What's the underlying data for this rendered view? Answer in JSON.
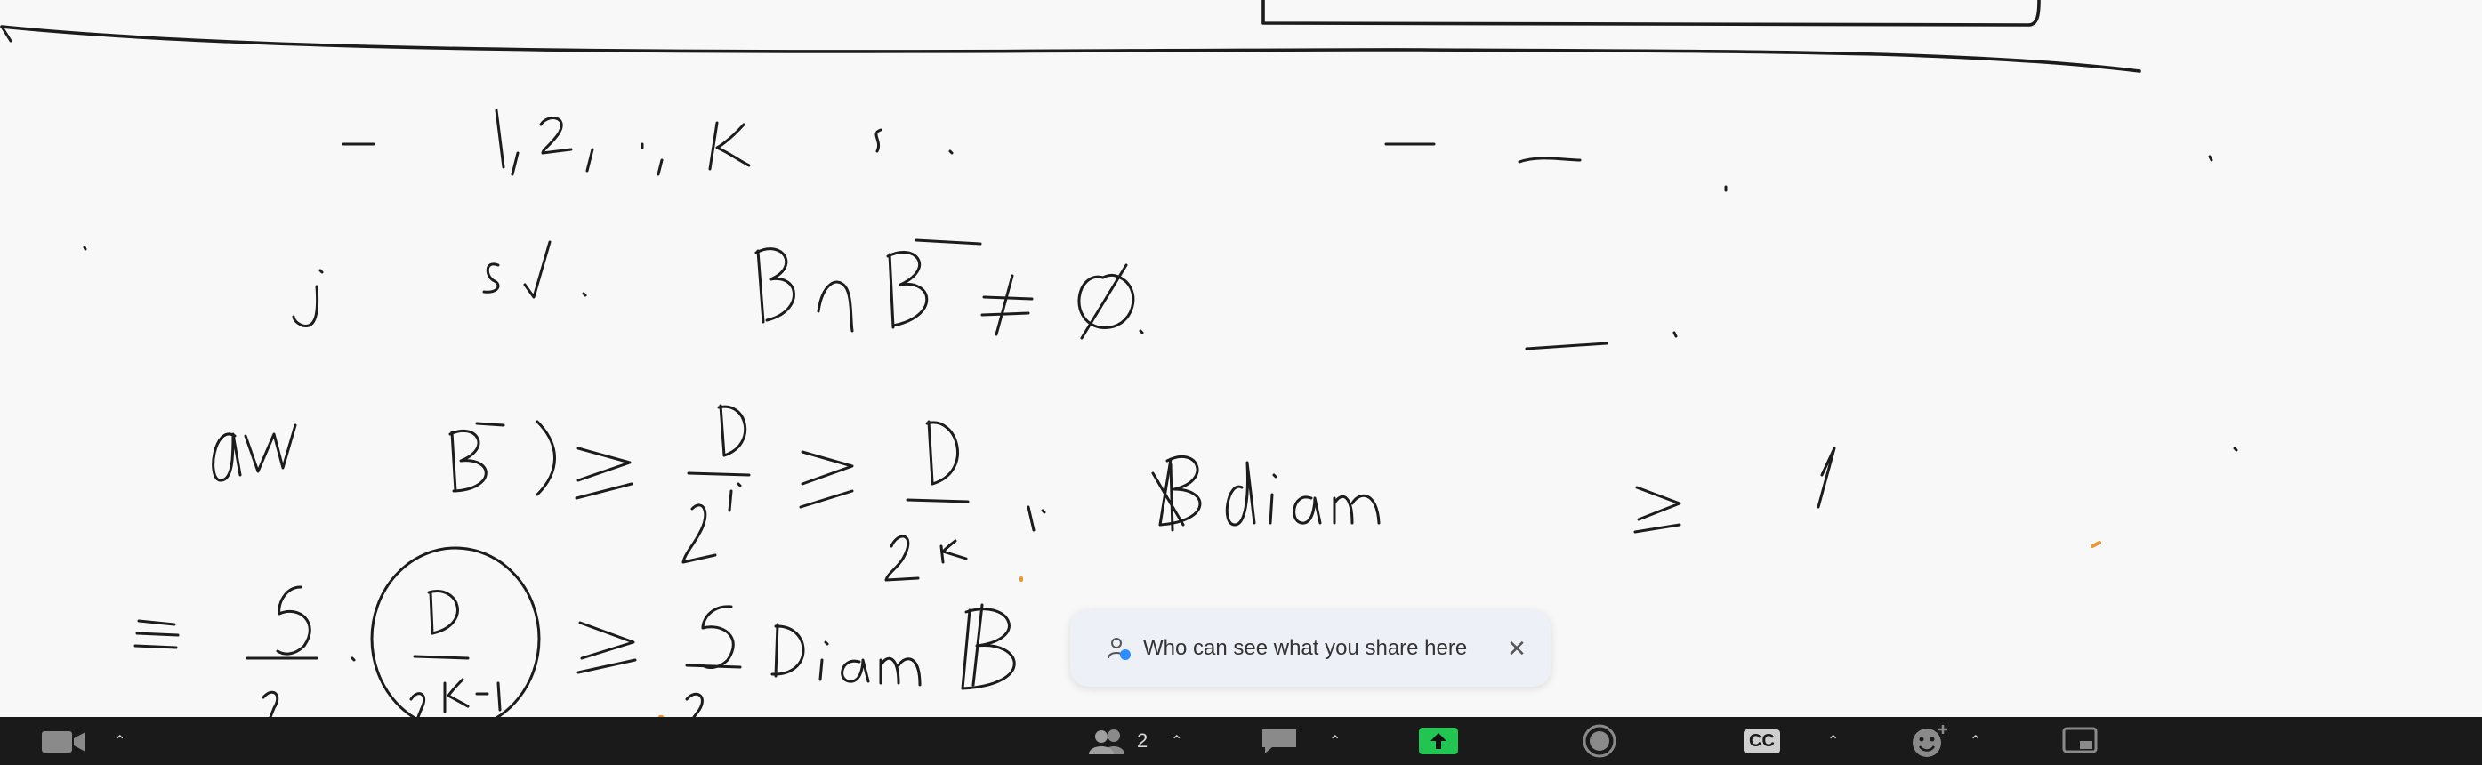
{
  "share_notice": {
    "message": "Who can see what you share here",
    "icon": "person-lock-icon",
    "close_icon": "close-icon"
  },
  "toolbar": {
    "video_icon": "video-camera-icon",
    "participants_icon": "participants-icon",
    "participants_count": "2",
    "chat_icon": "chat-icon",
    "share_icon": "share-screen-icon",
    "record_icon": "record-icon",
    "cc_label": "CC",
    "reactions_icon": "reactions-icon",
    "view_icon": "view-icon",
    "share_color": "#23c552"
  }
}
